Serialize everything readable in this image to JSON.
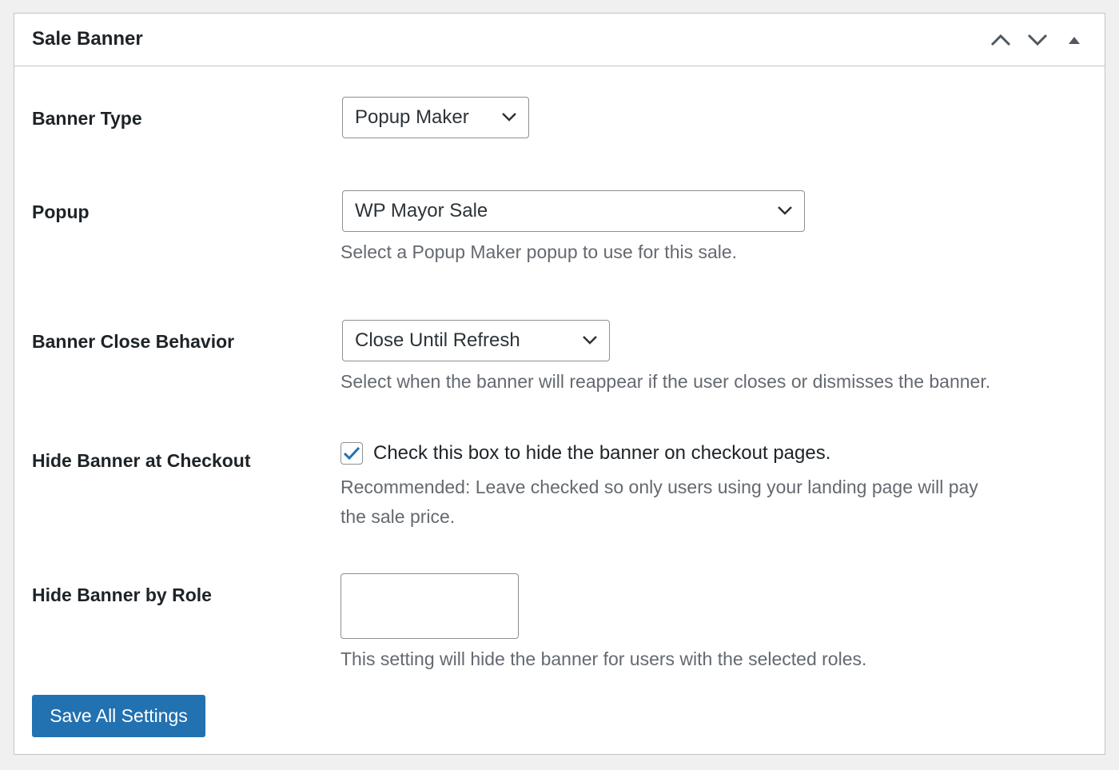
{
  "panel": {
    "title": "Sale Banner",
    "controls": [
      {
        "icon": "chevron-up-icon"
      },
      {
        "icon": "chevron-down-icon"
      },
      {
        "icon": "triangle-up-icon"
      }
    ]
  },
  "fields": {
    "banner_type": {
      "label": "Banner Type",
      "value": "Popup Maker"
    },
    "popup": {
      "label": "Popup",
      "value": "WP Mayor Sale",
      "description": "Select a Popup Maker popup to use for this sale."
    },
    "close_behavior": {
      "label": "Banner Close Behavior",
      "value": "Close Until Refresh",
      "description": "Select when the banner will reappear if the user closes or dismisses the banner."
    },
    "hide_checkout": {
      "label": "Hide Banner at Checkout",
      "checkbox_label": "Check this box to hide the banner on checkout pages.",
      "checked": true,
      "description_line1": "Recommended: Leave checked so only users using your landing page will pay",
      "description_line2": "the sale price."
    },
    "hide_role": {
      "label": "Hide Banner by Role",
      "description": "This setting will hide the banner for users with the selected roles."
    }
  },
  "save_button": {
    "label": "Save All Settings"
  },
  "colors": {
    "accent": "#2271b1",
    "check": "#2271b1"
  }
}
